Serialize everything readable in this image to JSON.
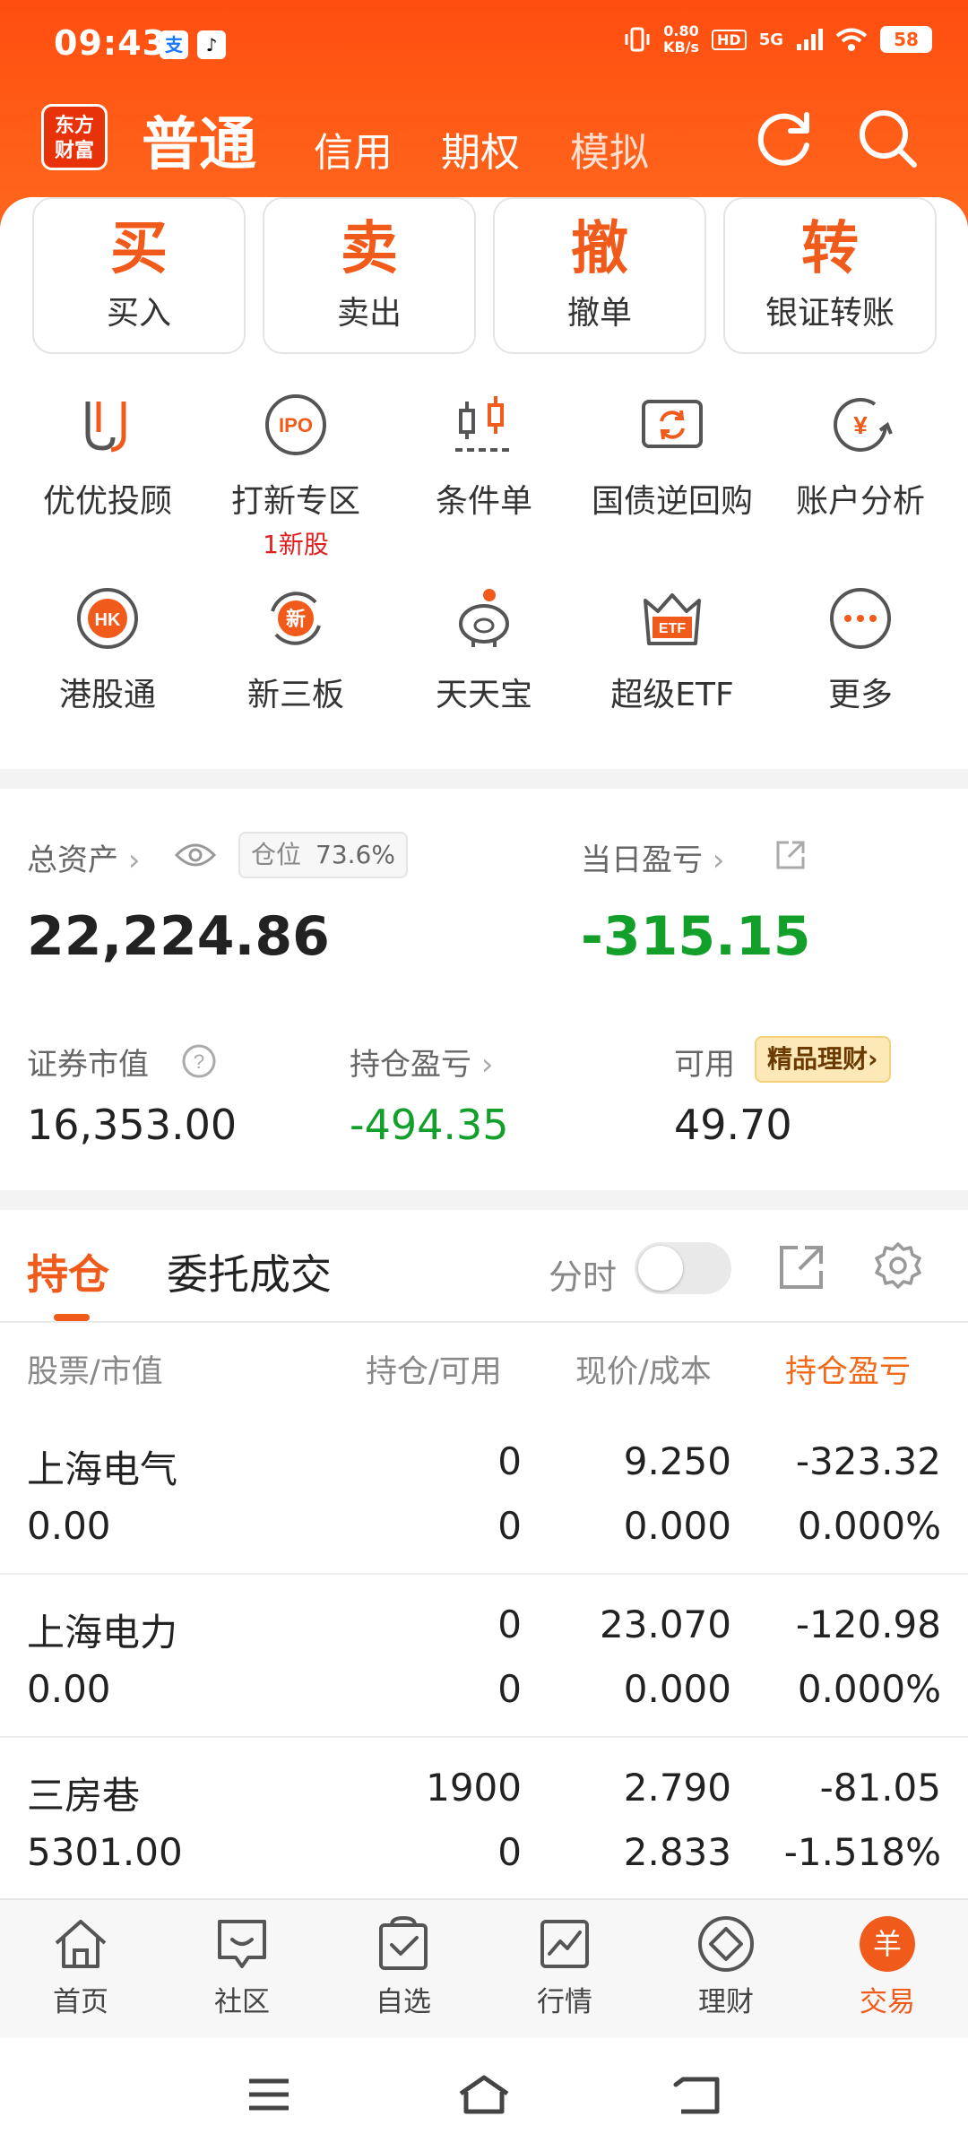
{
  "status_bar": {
    "time": "09:43",
    "badge1": "支",
    "badge2": "♪",
    "net_speed_value": "0.80",
    "net_speed_unit": "KB/s",
    "hd": "HD",
    "signal": "5G",
    "battery": "58"
  },
  "brand": {
    "logo_top": "东方",
    "logo_bottom": "财富"
  },
  "top_tabs": {
    "active": "普通",
    "t2": "信用",
    "t3": "期权",
    "t4": "模拟"
  },
  "trade_buttons": [
    {
      "icon_char": "买",
      "label": "买入"
    },
    {
      "icon_char": "卖",
      "label": "卖出"
    },
    {
      "icon_char": "撤",
      "label": "撤单"
    },
    {
      "icon_char": "转",
      "label": "银证转账"
    }
  ],
  "features_row1": [
    {
      "icon": "youyou-icon",
      "label": "优优投顾"
    },
    {
      "icon": "ipo-icon",
      "icon_text": "IPO",
      "label": "打新专区",
      "sub": "1新股"
    },
    {
      "icon": "condition-order-icon",
      "label": "条件单"
    },
    {
      "icon": "repo-icon",
      "label": "国债逆回购"
    },
    {
      "icon": "account-analysis-icon",
      "icon_text": "¥",
      "label": "账户分析"
    }
  ],
  "features_row2": [
    {
      "icon": "hk-icon",
      "icon_text": "HK",
      "label": "港股通"
    },
    {
      "icon": "new-third-board-icon",
      "icon_text": "新",
      "label": "新三板"
    },
    {
      "icon": "piggy-bank-icon",
      "label": "天天宝"
    },
    {
      "icon": "etf-icon",
      "icon_text": "ETF",
      "label": "超级ETF"
    },
    {
      "icon": "more-icon",
      "label": "更多"
    }
  ],
  "summary": {
    "total_assets_label": "总资产",
    "position_label": "仓位",
    "position_value": "73.6%",
    "total_assets": "22,224.86",
    "daily_pnl_label": "当日盈亏",
    "daily_pnl": "-315.15",
    "market_value_label": "证券市值",
    "market_value": "16,353.00",
    "holding_pnl_label": "持仓盈亏",
    "holding_pnl": "-494.35",
    "available_label": "可用",
    "available": "49.70",
    "promo": "精品理财"
  },
  "holdings": {
    "tab_active": "持仓",
    "tab_other": "委托成交",
    "fenshi_label": "分时",
    "headers": {
      "stock": "股票/市值",
      "qty": "持仓/可用",
      "price": "现价/成本",
      "pnl": "持仓盈亏"
    },
    "rows": [
      {
        "name": "上海电气",
        "market_value": "0.00",
        "qty": "0",
        "avail": "0",
        "price": "9.250",
        "cost": "0.000",
        "pnl": "-323.32",
        "pnl_pct": "0.000%"
      },
      {
        "name": "上海电力",
        "market_value": "0.00",
        "qty": "0",
        "avail": "0",
        "price": "23.070",
        "cost": "0.000",
        "pnl": "-120.98",
        "pnl_pct": "0.000%"
      },
      {
        "name": "三房巷",
        "market_value": "5301.00",
        "qty": "1900",
        "avail": "0",
        "price": "2.790",
        "cost": "2.833",
        "pnl": "-81.05",
        "pnl_pct": "-1.518%"
      }
    ]
  },
  "bottom_nav": [
    {
      "icon": "home-icon",
      "label": "首页"
    },
    {
      "icon": "community-icon",
      "label": "社区"
    },
    {
      "icon": "watchlist-icon",
      "label": "自选"
    },
    {
      "icon": "market-icon",
      "label": "行情"
    },
    {
      "icon": "wealth-icon",
      "label": "理财"
    },
    {
      "icon": "trade-icon",
      "icon_text": "羊",
      "label": "交易"
    }
  ],
  "colors": {
    "brand_orange": "#ff5a16",
    "accent": "#f05a1a",
    "loss_green": "#12a02a",
    "sub_red": "#e02020"
  }
}
